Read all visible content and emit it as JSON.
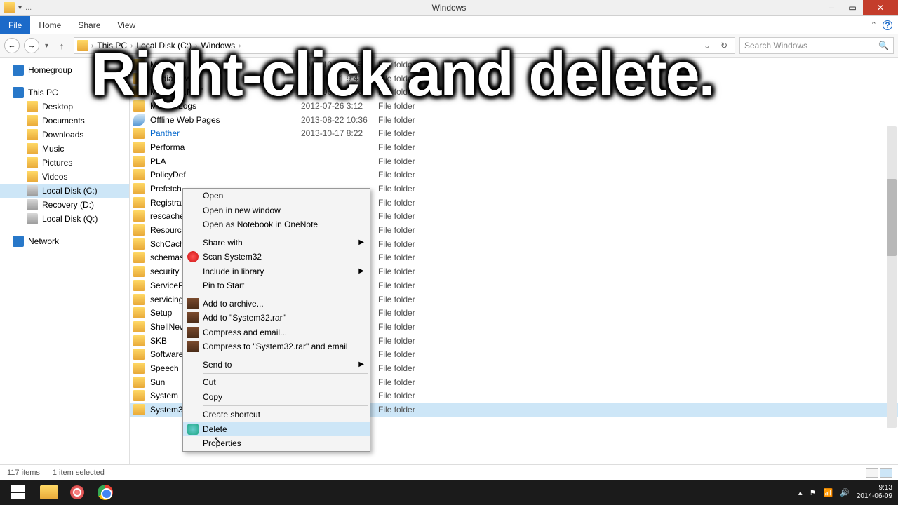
{
  "titlebar": {
    "title": "Windows",
    "tab_label": "..."
  },
  "ribbon": {
    "file": "File",
    "home": "Home",
    "share": "Share",
    "view": "View"
  },
  "breadcrumb": {
    "item1": "This PC",
    "item2": "Local Disk (C:)",
    "item3": "Windows"
  },
  "search": {
    "placeholder": "Search Windows"
  },
  "sidebar": {
    "homegroup": "Homegroup",
    "this_pc": "This PC",
    "desktop": "Desktop",
    "documents": "Documents",
    "downloads": "Downloads",
    "music": "Music",
    "pictures": "Pictures",
    "videos": "Videos",
    "local_c": "Local Disk (C:)",
    "recovery_d": "Recovery (D:)",
    "local_q": "Local Disk (Q:)",
    "network": "Network"
  },
  "files": [
    {
      "name": "M...",
      "date": "2013-10-17 8:15",
      "type": "File folder",
      "icon": "f"
    },
    {
      "name": "MediaViewer",
      "date": "2014-04-21 9:41",
      "type": "File folder",
      "icon": "f"
    },
    {
      "name": "Microsoft.NET",
      "date": "2014-06-09 9:06",
      "type": "File folder",
      "icon": "f"
    },
    {
      "name": "ModemLogs",
      "date": "2012-07-26 3:12",
      "type": "File folder",
      "icon": "f"
    },
    {
      "name": "Offline Web Pages",
      "date": "2013-08-22 10:36",
      "type": "File folder",
      "icon": "w"
    },
    {
      "name": "Panther",
      "date": "2013-10-17 8:22",
      "type": "File folder",
      "icon": "f",
      "pan": true
    },
    {
      "name": "Performa",
      "date": "",
      "type": "File folder",
      "icon": "f"
    },
    {
      "name": "PLA",
      "date": "",
      "type": "File folder",
      "icon": "f"
    },
    {
      "name": "PolicyDef",
      "date": "",
      "type": "File folder",
      "icon": "f"
    },
    {
      "name": "Prefetch",
      "date": "",
      "type": "File folder",
      "icon": "f"
    },
    {
      "name": "Registrat",
      "date": "",
      "type": "File folder",
      "icon": "f"
    },
    {
      "name": "rescache",
      "date": "",
      "type": "File folder",
      "icon": "f"
    },
    {
      "name": "Resource",
      "date": "",
      "type": "File folder",
      "icon": "f"
    },
    {
      "name": "SchCache",
      "date": "",
      "type": "File folder",
      "icon": "f"
    },
    {
      "name": "schemas",
      "date": "",
      "type": "File folder",
      "icon": "f"
    },
    {
      "name": "security",
      "date": "",
      "type": "File folder",
      "icon": "f"
    },
    {
      "name": "ServicePr",
      "date": "",
      "type": "File folder",
      "icon": "f"
    },
    {
      "name": "servicing",
      "date": "",
      "type": "File folder",
      "icon": "f"
    },
    {
      "name": "Setup",
      "date": "",
      "type": "File folder",
      "icon": "f"
    },
    {
      "name": "ShellNew",
      "date": "",
      "type": "File folder",
      "icon": "f"
    },
    {
      "name": "SKB",
      "date": "",
      "type": "File folder",
      "icon": "f"
    },
    {
      "name": "Software",
      "date": "",
      "type": "File folder",
      "icon": "f"
    },
    {
      "name": "Speech",
      "date": "",
      "type": "File folder",
      "icon": "f"
    },
    {
      "name": "Sun",
      "date": "",
      "type": "File folder",
      "icon": "f"
    },
    {
      "name": "System",
      "date": "",
      "type": "File folder",
      "icon": "f"
    },
    {
      "name": "System32",
      "date": "",
      "type": "File folder",
      "icon": "f",
      "sel": true
    }
  ],
  "context": {
    "open": "Open",
    "open_new": "Open in new window",
    "onenote": "Open as Notebook in OneNote",
    "share_with": "Share with",
    "scan": "Scan System32",
    "include": "Include in library",
    "pin": "Pin to Start",
    "add_archive": "Add to archive...",
    "add_rar": "Add to \"System32.rar\"",
    "compress": "Compress and email...",
    "compress_rar": "Compress to \"System32.rar\" and email",
    "send_to": "Send to",
    "cut": "Cut",
    "copy": "Copy",
    "shortcut": "Create shortcut",
    "delete": "Delete",
    "properties": "Properties"
  },
  "status": {
    "items": "117 items",
    "selected": "1 item selected"
  },
  "overlay": "Right-click and delete.",
  "tray": {
    "time": "9:13",
    "date": "2014-06-09"
  }
}
